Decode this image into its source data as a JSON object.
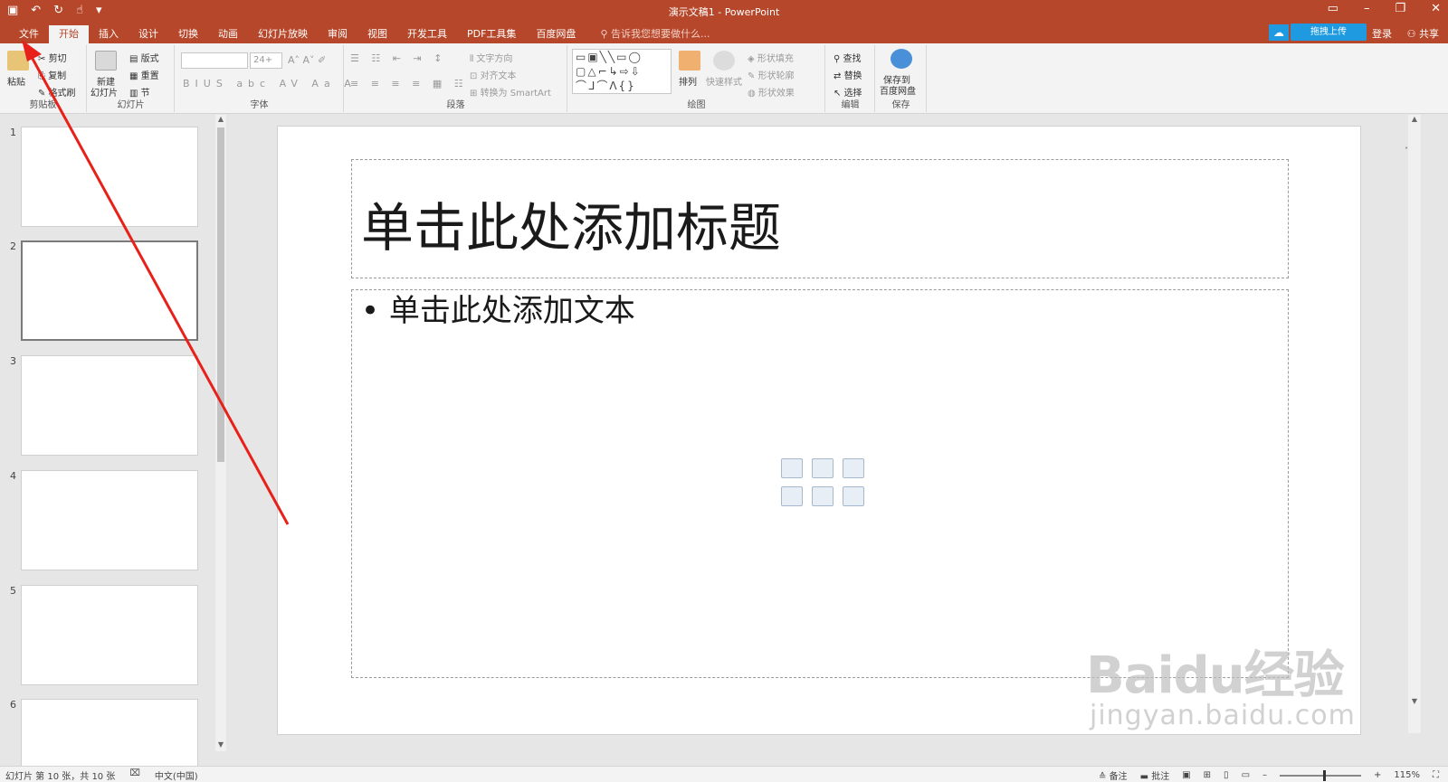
{
  "window": {
    "title": "演示文稿1 - PowerPoint",
    "qat_icons": [
      "save-icon",
      "undo-icon",
      "redo-icon",
      "touch-mode-icon",
      "customize-icon"
    ]
  },
  "tabs": [
    "文件",
    "开始",
    "插入",
    "设计",
    "切换",
    "动画",
    "幻灯片放映",
    "审阅",
    "视图",
    "开发工具",
    "PDF工具集",
    "百度网盘"
  ],
  "active_tab": "开始",
  "tell_me": "告诉我您想要做什么...",
  "account": {
    "upload": "拖拽上传",
    "login": "登录",
    "share": "共享"
  },
  "ribbon": {
    "clipboard": {
      "label": "剪贴板",
      "paste": "粘贴",
      "cut": "剪切",
      "copy": "复制",
      "format_painter": "格式刷"
    },
    "slides": {
      "label": "幻灯片",
      "new_slide": "新建",
      "new_slide2": "幻灯片",
      "layout": "版式",
      "reset": "重置",
      "section": "节"
    },
    "font": {
      "label": "字体",
      "font_name": "",
      "font_size": "24+"
    },
    "paragraph": {
      "label": "段落",
      "text_direction": "文字方向",
      "align_text": "对齐文本",
      "smartart": "转换为 SmartArt"
    },
    "drawing": {
      "label": "绘图",
      "arrange": "排列",
      "quick_styles": "快速样式",
      "shape_fill": "形状填充",
      "shape_outline": "形状轮廓",
      "shape_effects": "形状效果"
    },
    "editing": {
      "label": "编辑",
      "find": "查找",
      "replace": "替换",
      "select": "选择"
    },
    "save": {
      "label": "保存",
      "save_to": "保存到",
      "baidu": "百度网盘"
    }
  },
  "thumbnails": [
    "1",
    "2",
    "3",
    "4",
    "5",
    "6"
  ],
  "selected_thumbnail": "2",
  "slide": {
    "title_placeholder": "单击此处添加标题",
    "body_placeholder": "单击此处添加文本",
    "bullet": "•"
  },
  "watermark": {
    "main": "Bai",
    "paw": "du",
    "brand": "经验",
    "sub": "jingyan.baidu.com"
  },
  "status": {
    "slide_info": "幻灯片 第 10 张，共 10 张",
    "language": "中文(中国)",
    "notes": "备注",
    "comments": "批注",
    "zoom": "115%"
  },
  "colors": {
    "accent": "#b7472a",
    "annotation": "#e8201a"
  }
}
